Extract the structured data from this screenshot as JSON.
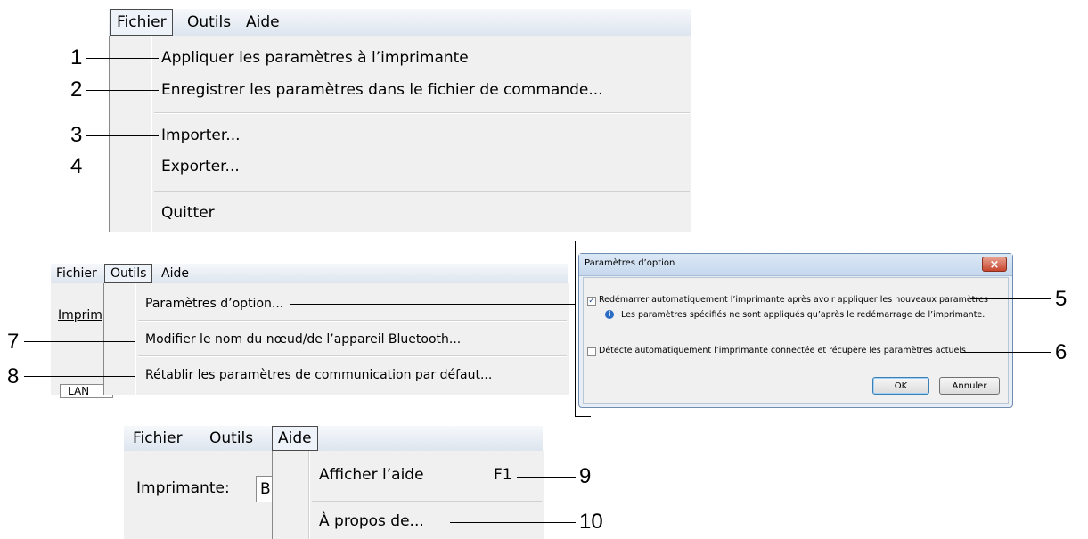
{
  "panel1": {
    "menubar": [
      "Fichier",
      "Outils",
      "Aide"
    ],
    "items": [
      "Appliquer les paramètres à l’imprimante",
      "Enregistrer les paramètres dans le fichier de commande...",
      "Importer...",
      "Exporter...",
      "Quitter"
    ]
  },
  "panel2": {
    "menubar": [
      "Fichier",
      "Outils",
      "Aide"
    ],
    "behind": {
      "imprim": "Imprim",
      "lan": "LAN"
    },
    "items": [
      "Paramètres d’option...",
      "Modifier le nom du nœud/de l’appareil Bluetooth...",
      "Rétablir les paramètres de communication par défaut..."
    ]
  },
  "panel3": {
    "menubar": [
      "Fichier",
      "Outils",
      "Aide"
    ],
    "behind": {
      "label": "Imprimante:",
      "field": "B"
    },
    "items": [
      {
        "label": "Afficher l’aide",
        "shortcut": "F1"
      },
      {
        "label": "À propos de..."
      }
    ]
  },
  "dialog": {
    "title": "Paramètres d’option",
    "close": "×",
    "option1": "Redémarrer automatiquement l’imprimante après avoir appliquer les nouveaux paramètres",
    "option1_checked": true,
    "info": "Les paramètres spécifiés ne sont appliqués qu’après le redémarrage de l’imprimante.",
    "option2": "Détecte automatiquement l’imprimante connectée et récupère les paramètres actuels",
    "option2_checked": false,
    "ok": "OK",
    "cancel": "Annuler"
  },
  "callouts": [
    "1",
    "2",
    "3",
    "4",
    "5",
    "6",
    "7",
    "8",
    "9",
    "10"
  ]
}
